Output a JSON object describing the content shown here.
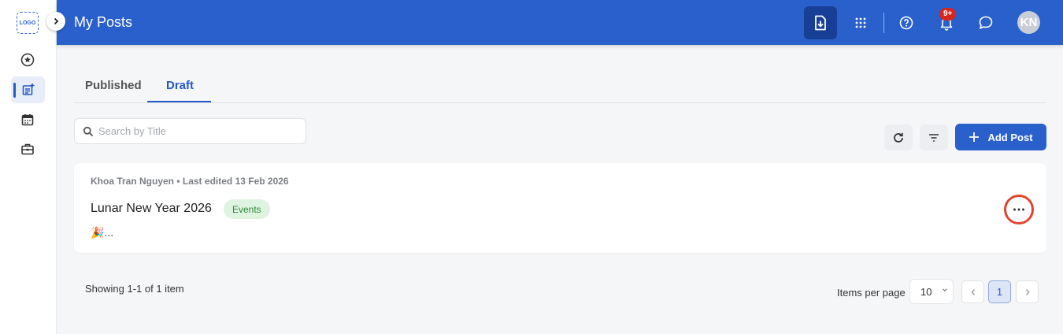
{
  "sidebar": {
    "logo": "LOGO",
    "items": [
      {
        "icon": "star-circle-icon"
      },
      {
        "icon": "post-add-icon"
      },
      {
        "icon": "calendar-icon"
      },
      {
        "icon": "briefcase-icon"
      }
    ]
  },
  "header": {
    "title": "My Posts",
    "notification_badge": "9+",
    "avatar_initials": "KN"
  },
  "tabs": [
    {
      "label": "Published"
    },
    {
      "label": "Draft",
      "active": true
    }
  ],
  "search": {
    "placeholder": "Search by Title",
    "value": ""
  },
  "toolbar": {
    "add_label": "Add Post"
  },
  "posts": [
    {
      "author": "Khoa Tran Nguyen",
      "meta": "Khoa Tran Nguyen • Last edited 13 Feb 2026",
      "title": "Lunar New Year 2026",
      "tag": "Events",
      "excerpt": "🎉..."
    }
  ],
  "footer": {
    "showing": "Showing 1-1 of 1 item",
    "items_per_page_label": "Items per page",
    "items_per_page_value": "10",
    "current_page": "1"
  },
  "colors": {
    "primary": "#2960cc",
    "header_active": "#173f95",
    "badge": "#d7261e",
    "tag_bg": "#dff3e1",
    "tag_text": "#2f8a3b",
    "highlight_ring": "#e4442f"
  }
}
